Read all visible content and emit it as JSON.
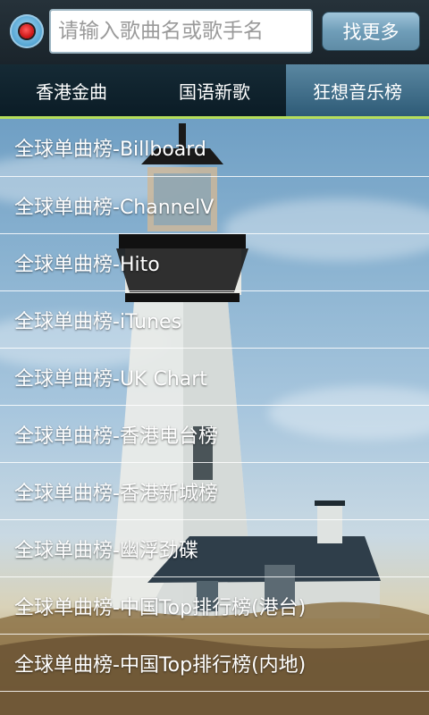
{
  "search": {
    "placeholder": "请输入歌曲名或歌手名",
    "more_label": "找更多"
  },
  "tabs": [
    {
      "label": "香港金曲",
      "active": false
    },
    {
      "label": "国语新歌",
      "active": false
    },
    {
      "label": "狂想音乐榜",
      "active": true
    }
  ],
  "list": [
    {
      "label": "全球单曲榜-Billboard"
    },
    {
      "label": "全球单曲榜-ChannelV"
    },
    {
      "label": "全球单曲榜-Hito"
    },
    {
      "label": "全球单曲榜-iTunes"
    },
    {
      "label": "全球单曲榜-UK Chart"
    },
    {
      "label": "全球单曲榜-香港电台榜"
    },
    {
      "label": "全球单曲榜-香港新城榜"
    },
    {
      "label": "全球单曲榜-幽浮劲碟"
    },
    {
      "label": "全球单曲榜-中国Top排行榜(港台)"
    },
    {
      "label": "全球单曲榜-中国Top排行榜(内地)"
    }
  ],
  "colors": {
    "tab_accent": "#b6de5b",
    "record_dot": "#c80f0f"
  },
  "icons": {
    "record": "record-icon"
  }
}
